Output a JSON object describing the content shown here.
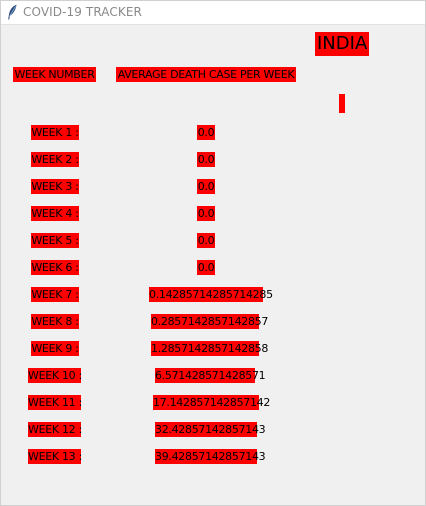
{
  "window": {
    "title": "COVID-19 TRACKER"
  },
  "country": "INDIA",
  "headers": {
    "week_number": "WEEK NUMBER",
    "average_death": "AVERAGE DEATH CASE PER WEEK"
  },
  "rows": [
    {
      "week": "WEEK 1 :",
      "value": "0.0"
    },
    {
      "week": "WEEK 2 :",
      "value": "0.0"
    },
    {
      "week": "WEEK 3 :",
      "value": "0.0"
    },
    {
      "week": "WEEK 4 :",
      "value": "0.0"
    },
    {
      "week": "WEEK 5 :",
      "value": "0.0"
    },
    {
      "week": "WEEK 6 :",
      "value": "0.0"
    },
    {
      "week": "WEEK 7 :",
      "value": "0.14285714285714285"
    },
    {
      "week": "WEEK 8 :",
      "value": "0.2857142857142857"
    },
    {
      "week": "WEEK 9 :",
      "value": "1.2857142857142858"
    },
    {
      "week": "WEEK 10 :",
      "value": "6.571428571428571"
    },
    {
      "week": "WEEK 11 :",
      "value": "17.142857142857142"
    },
    {
      "week": "WEEK 12 :",
      "value": "32.42857142857143"
    },
    {
      "week": "WEEK 13 :",
      "value": "39.42857142857143"
    }
  ],
  "colors": {
    "label_background": "#ff0000",
    "window_background": "#f0f0f0"
  },
  "icons": {
    "app": "feather-icon"
  }
}
